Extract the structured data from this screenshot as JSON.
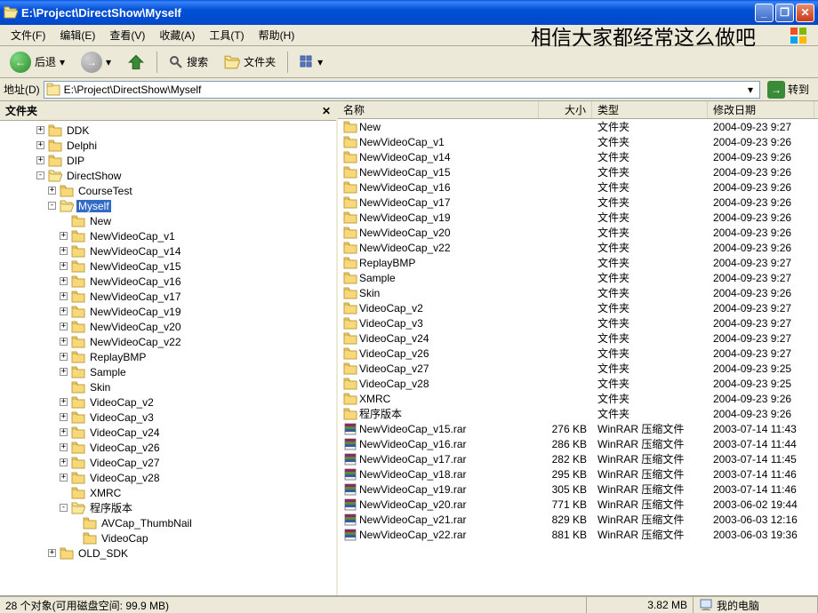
{
  "window": {
    "title": "E:\\Project\\DirectShow\\Myself"
  },
  "menubar": {
    "items": [
      "文件(F)",
      "编辑(E)",
      "查看(V)",
      "收藏(A)",
      "工具(T)",
      "帮助(H)"
    ],
    "overlay": "相信大家都经常这么做吧"
  },
  "toolbar": {
    "back": "后退",
    "search": "搜索",
    "folders": "文件夹"
  },
  "addressbar": {
    "label": "地址(D)",
    "value": "E:\\Project\\DirectShow\\Myself",
    "go": "转到"
  },
  "sidebar": {
    "title": "文件夹",
    "tree": [
      {
        "indent": 3,
        "toggle": "+",
        "icon": "folder",
        "label": "DDK"
      },
      {
        "indent": 3,
        "toggle": "+",
        "icon": "folder",
        "label": "Delphi"
      },
      {
        "indent": 3,
        "toggle": "+",
        "icon": "folder",
        "label": "DIP"
      },
      {
        "indent": 3,
        "toggle": "-",
        "icon": "folder-open",
        "label": "DirectShow"
      },
      {
        "indent": 4,
        "toggle": "+",
        "icon": "folder",
        "label": "CourseTest"
      },
      {
        "indent": 4,
        "toggle": "-",
        "icon": "folder-open",
        "label": "Myself",
        "selected": true
      },
      {
        "indent": 5,
        "toggle": "",
        "icon": "folder",
        "label": "New"
      },
      {
        "indent": 5,
        "toggle": "+",
        "icon": "folder",
        "label": "NewVideoCap_v1"
      },
      {
        "indent": 5,
        "toggle": "+",
        "icon": "folder",
        "label": "NewVideoCap_v14"
      },
      {
        "indent": 5,
        "toggle": "+",
        "icon": "folder",
        "label": "NewVideoCap_v15"
      },
      {
        "indent": 5,
        "toggle": "+",
        "icon": "folder",
        "label": "NewVideoCap_v16"
      },
      {
        "indent": 5,
        "toggle": "+",
        "icon": "folder",
        "label": "NewVideoCap_v17"
      },
      {
        "indent": 5,
        "toggle": "+",
        "icon": "folder",
        "label": "NewVideoCap_v19"
      },
      {
        "indent": 5,
        "toggle": "+",
        "icon": "folder",
        "label": "NewVideoCap_v20"
      },
      {
        "indent": 5,
        "toggle": "+",
        "icon": "folder",
        "label": "NewVideoCap_v22"
      },
      {
        "indent": 5,
        "toggle": "+",
        "icon": "folder",
        "label": "ReplayBMP"
      },
      {
        "indent": 5,
        "toggle": "+",
        "icon": "folder",
        "label": "Sample"
      },
      {
        "indent": 5,
        "toggle": "",
        "icon": "folder",
        "label": "Skin"
      },
      {
        "indent": 5,
        "toggle": "+",
        "icon": "folder",
        "label": "VideoCap_v2"
      },
      {
        "indent": 5,
        "toggle": "+",
        "icon": "folder",
        "label": "VideoCap_v3"
      },
      {
        "indent": 5,
        "toggle": "+",
        "icon": "folder",
        "label": "VideoCap_v24"
      },
      {
        "indent": 5,
        "toggle": "+",
        "icon": "folder",
        "label": "VideoCap_v26"
      },
      {
        "indent": 5,
        "toggle": "+",
        "icon": "folder",
        "label": "VideoCap_v27"
      },
      {
        "indent": 5,
        "toggle": "+",
        "icon": "folder",
        "label": "VideoCap_v28"
      },
      {
        "indent": 5,
        "toggle": "",
        "icon": "folder",
        "label": "XMRC"
      },
      {
        "indent": 5,
        "toggle": "-",
        "icon": "folder-open",
        "label": "程序版本"
      },
      {
        "indent": 6,
        "toggle": "",
        "icon": "folder",
        "label": "AVCap_ThumbNail"
      },
      {
        "indent": 6,
        "toggle": "",
        "icon": "folder",
        "label": "VideoCap"
      },
      {
        "indent": 4,
        "toggle": "+",
        "icon": "folder",
        "label": "OLD_SDK"
      }
    ]
  },
  "list": {
    "columns": {
      "name": "名称",
      "size": "大小",
      "type": "类型",
      "date": "修改日期"
    },
    "rows": [
      {
        "icon": "folder",
        "name": "New",
        "size": "",
        "type": "文件夹",
        "date": "2004-09-23 9:27"
      },
      {
        "icon": "folder",
        "name": "NewVideoCap_v1",
        "size": "",
        "type": "文件夹",
        "date": "2004-09-23 9:26"
      },
      {
        "icon": "folder",
        "name": "NewVideoCap_v14",
        "size": "",
        "type": "文件夹",
        "date": "2004-09-23 9:26"
      },
      {
        "icon": "folder",
        "name": "NewVideoCap_v15",
        "size": "",
        "type": "文件夹",
        "date": "2004-09-23 9:26"
      },
      {
        "icon": "folder",
        "name": "NewVideoCap_v16",
        "size": "",
        "type": "文件夹",
        "date": "2004-09-23 9:26"
      },
      {
        "icon": "folder",
        "name": "NewVideoCap_v17",
        "size": "",
        "type": "文件夹",
        "date": "2004-09-23 9:26"
      },
      {
        "icon": "folder",
        "name": "NewVideoCap_v19",
        "size": "",
        "type": "文件夹",
        "date": "2004-09-23 9:26"
      },
      {
        "icon": "folder",
        "name": "NewVideoCap_v20",
        "size": "",
        "type": "文件夹",
        "date": "2004-09-23 9:26"
      },
      {
        "icon": "folder",
        "name": "NewVideoCap_v22",
        "size": "",
        "type": "文件夹",
        "date": "2004-09-23 9:26"
      },
      {
        "icon": "folder",
        "name": "ReplayBMP",
        "size": "",
        "type": "文件夹",
        "date": "2004-09-23 9:27"
      },
      {
        "icon": "folder",
        "name": "Sample",
        "size": "",
        "type": "文件夹",
        "date": "2004-09-23 9:27"
      },
      {
        "icon": "folder",
        "name": "Skin",
        "size": "",
        "type": "文件夹",
        "date": "2004-09-23 9:26"
      },
      {
        "icon": "folder",
        "name": "VideoCap_v2",
        "size": "",
        "type": "文件夹",
        "date": "2004-09-23 9:27"
      },
      {
        "icon": "folder",
        "name": "VideoCap_v3",
        "size": "",
        "type": "文件夹",
        "date": "2004-09-23 9:27"
      },
      {
        "icon": "folder",
        "name": "VideoCap_v24",
        "size": "",
        "type": "文件夹",
        "date": "2004-09-23 9:27"
      },
      {
        "icon": "folder",
        "name": "VideoCap_v26",
        "size": "",
        "type": "文件夹",
        "date": "2004-09-23 9:27"
      },
      {
        "icon": "folder",
        "name": "VideoCap_v27",
        "size": "",
        "type": "文件夹",
        "date": "2004-09-23 9:25"
      },
      {
        "icon": "folder",
        "name": "VideoCap_v28",
        "size": "",
        "type": "文件夹",
        "date": "2004-09-23 9:25"
      },
      {
        "icon": "folder",
        "name": "XMRC",
        "size": "",
        "type": "文件夹",
        "date": "2004-09-23 9:26"
      },
      {
        "icon": "folder",
        "name": "程序版本",
        "size": "",
        "type": "文件夹",
        "date": "2004-09-23 9:26"
      },
      {
        "icon": "rar",
        "name": "NewVideoCap_v15.rar",
        "size": "276 KB",
        "type": "WinRAR 压缩文件",
        "date": "2003-07-14 11:43"
      },
      {
        "icon": "rar",
        "name": "NewVideoCap_v16.rar",
        "size": "286 KB",
        "type": "WinRAR 压缩文件",
        "date": "2003-07-14 11:44"
      },
      {
        "icon": "rar",
        "name": "NewVideoCap_v17.rar",
        "size": "282 KB",
        "type": "WinRAR 压缩文件",
        "date": "2003-07-14 11:45"
      },
      {
        "icon": "rar",
        "name": "NewVideoCap_v18.rar",
        "size": "295 KB",
        "type": "WinRAR 压缩文件",
        "date": "2003-07-14 11:46"
      },
      {
        "icon": "rar",
        "name": "NewVideoCap_v19.rar",
        "size": "305 KB",
        "type": "WinRAR 压缩文件",
        "date": "2003-07-14 11:46"
      },
      {
        "icon": "rar",
        "name": "NewVideoCap_v20.rar",
        "size": "771 KB",
        "type": "WinRAR 压缩文件",
        "date": "2003-06-02 19:44"
      },
      {
        "icon": "rar",
        "name": "NewVideoCap_v21.rar",
        "size": "829 KB",
        "type": "WinRAR 压缩文件",
        "date": "2003-06-03 12:16"
      },
      {
        "icon": "rar",
        "name": "NewVideoCap_v22.rar",
        "size": "881 KB",
        "type": "WinRAR 压缩文件",
        "date": "2003-06-03 19:36"
      }
    ]
  },
  "statusbar": {
    "objects": "28 个对象(可用磁盘空间: 99.9 MB)",
    "size": "3.82 MB",
    "location": "我的电脑"
  }
}
